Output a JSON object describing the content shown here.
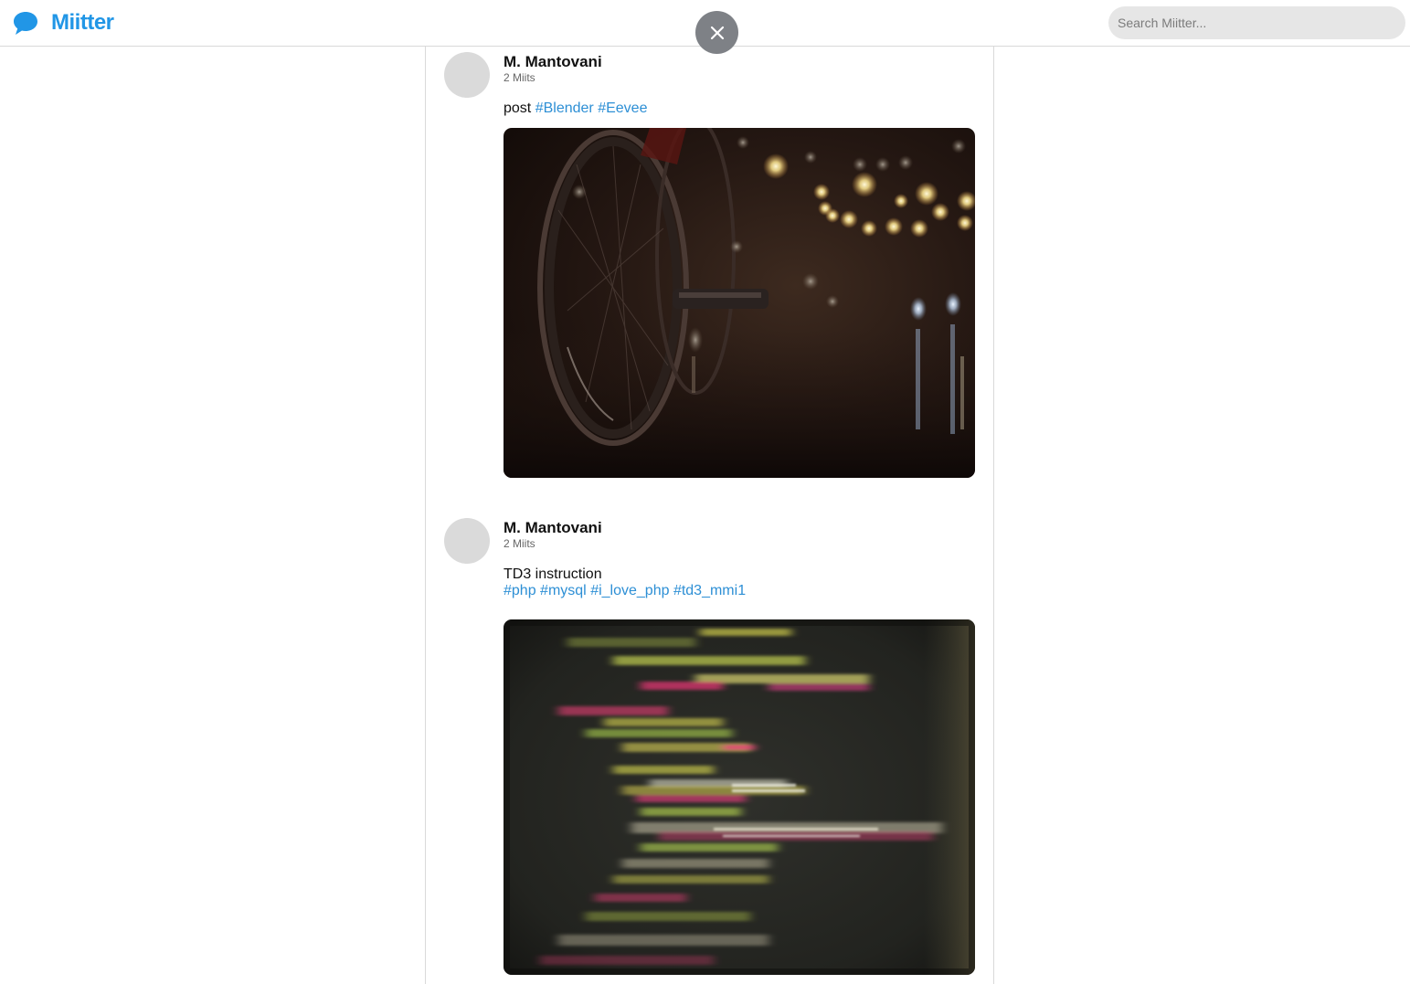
{
  "header": {
    "app_name": "Miitter",
    "logo_icon": "speech-bubble-icon",
    "brand_color": "#2196e6",
    "search_placeholder": "Search Miitter..."
  },
  "overlay": {
    "close_icon": "close-icon"
  },
  "posts": [
    {
      "author": "M. Mantovani",
      "count": "2 Miits",
      "text": "post",
      "tags": [
        "#Blender",
        "#Eevee"
      ],
      "image": "night scene with bicycle wheel and glowing bokeh lights"
    },
    {
      "author": "M. Mantovani",
      "count": "2 Miits",
      "text": "TD3 instruction",
      "tags": [
        "#php",
        "#mysql",
        "#i_love_php",
        "#td3_mmi1"
      ],
      "image": "blurred code on a dark screen"
    }
  ],
  "colors": {
    "hashtag": "#2d8fd5",
    "avatar_placeholder": "#dadada",
    "search_bg": "#e6e6e6",
    "close_button_bg": "#7e8186"
  }
}
